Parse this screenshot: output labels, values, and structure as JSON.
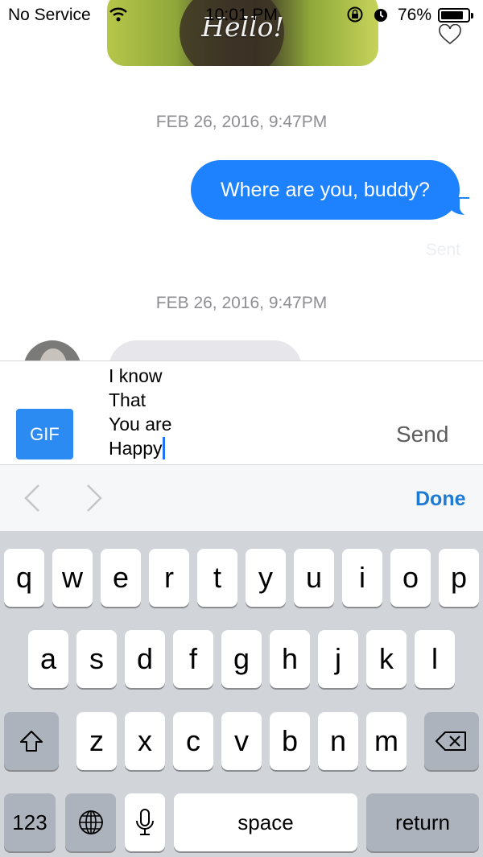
{
  "status_bar": {
    "carrier": "No Service",
    "time": "10:01 PM",
    "battery": "76%"
  },
  "conversation": {
    "image_caption": "Hello!",
    "timestamp_1": "FEB 26, 2016, 9:47PM",
    "outgoing_message": "Where are you, buddy?",
    "delivery_status": "Sent",
    "timestamp_2": "FEB 26, 2016, 9:47PM"
  },
  "composer": {
    "gif_label": "GIF",
    "text_lines": [
      "I know",
      "That",
      "You are",
      "Happy"
    ],
    "send_label": "Send"
  },
  "accessory_bar": {
    "done_label": "Done"
  },
  "keyboard": {
    "row1": [
      "q",
      "w",
      "e",
      "r",
      "t",
      "y",
      "u",
      "i",
      "o",
      "p"
    ],
    "row2": [
      "a",
      "s",
      "d",
      "f",
      "g",
      "h",
      "j",
      "k",
      "l"
    ],
    "row3": [
      "z",
      "x",
      "c",
      "v",
      "b",
      "n",
      "m"
    ],
    "numbers_label": "123",
    "space_label": "space",
    "return_label": "return"
  },
  "colors": {
    "imessage_blue": "#1e82ff",
    "gif_button": "#2c8bf2",
    "done_blue": "#1e7bd4",
    "keyboard_bg": "#d1d4d9"
  }
}
